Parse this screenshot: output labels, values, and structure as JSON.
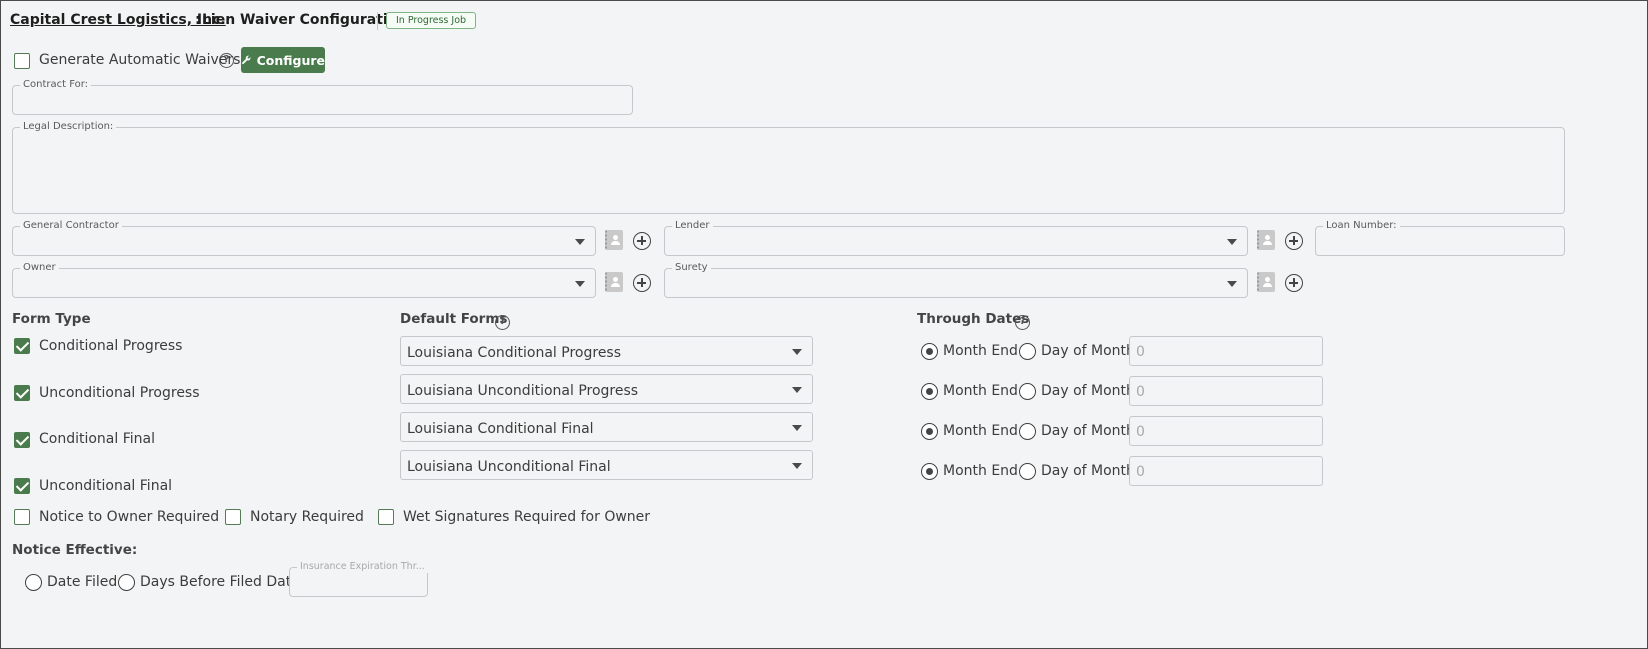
{
  "header": {
    "company": "Capital Crest Logistics, Inc.",
    "separator": ":",
    "title": "Lien Waiver Configuration",
    "status_badge": "In Progress Job"
  },
  "auto_waivers": {
    "label": "Generate Automatic Waivers",
    "checked": false,
    "help": "?",
    "configure_label": "Configure"
  },
  "fields": {
    "contract_for": {
      "label": "Contract For:",
      "value": ""
    },
    "legal_description": {
      "label": "Legal Description:",
      "value": ""
    },
    "general_contractor": {
      "label": "General Contractor",
      "value": ""
    },
    "lender": {
      "label": "Lender",
      "value": ""
    },
    "loan_number": {
      "label": "Loan Number:",
      "value": ""
    },
    "owner": {
      "label": "Owner",
      "value": ""
    },
    "surety": {
      "label": "Surety",
      "value": ""
    }
  },
  "form_type": {
    "heading": "Form Type",
    "items": [
      {
        "label": "Conditional Progress",
        "checked": true
      },
      {
        "label": "Unconditional Progress",
        "checked": true
      },
      {
        "label": "Conditional Final",
        "checked": true
      },
      {
        "label": "Unconditional Final",
        "checked": true
      }
    ]
  },
  "default_forms": {
    "heading": "Default Forms",
    "help": "?",
    "items": [
      "Louisiana Conditional Progress",
      "Louisiana Unconditional Progress",
      "Louisiana Conditional Final",
      "Louisiana Unconditional Final"
    ]
  },
  "through_dates": {
    "heading": "Through Dates",
    "help": "?",
    "month_end_label": "Month End",
    "day_of_month_label": "Day of Month",
    "rows": [
      {
        "selected": "month_end",
        "day_value": "0"
      },
      {
        "selected": "month_end",
        "day_value": "0"
      },
      {
        "selected": "month_end",
        "day_value": "0"
      },
      {
        "selected": "month_end",
        "day_value": "0"
      }
    ]
  },
  "options": {
    "notice_to_owner": {
      "label": "Notice to Owner Required",
      "checked": false
    },
    "notary": {
      "label": "Notary Required",
      "checked": false
    },
    "wet_signatures": {
      "label": "Wet Signatures Required for Owner",
      "checked": false
    }
  },
  "notice_effective": {
    "heading": "Notice Effective:",
    "date_filed_label": "Date Filed",
    "days_before_label": "Days Before Filed Date:",
    "insurance_placeholder": "Insurance Expiration Thr..."
  },
  "colors": {
    "accent": "#4a7b4d",
    "background": "#f3f4f5",
    "border": "#c5c8cb"
  }
}
